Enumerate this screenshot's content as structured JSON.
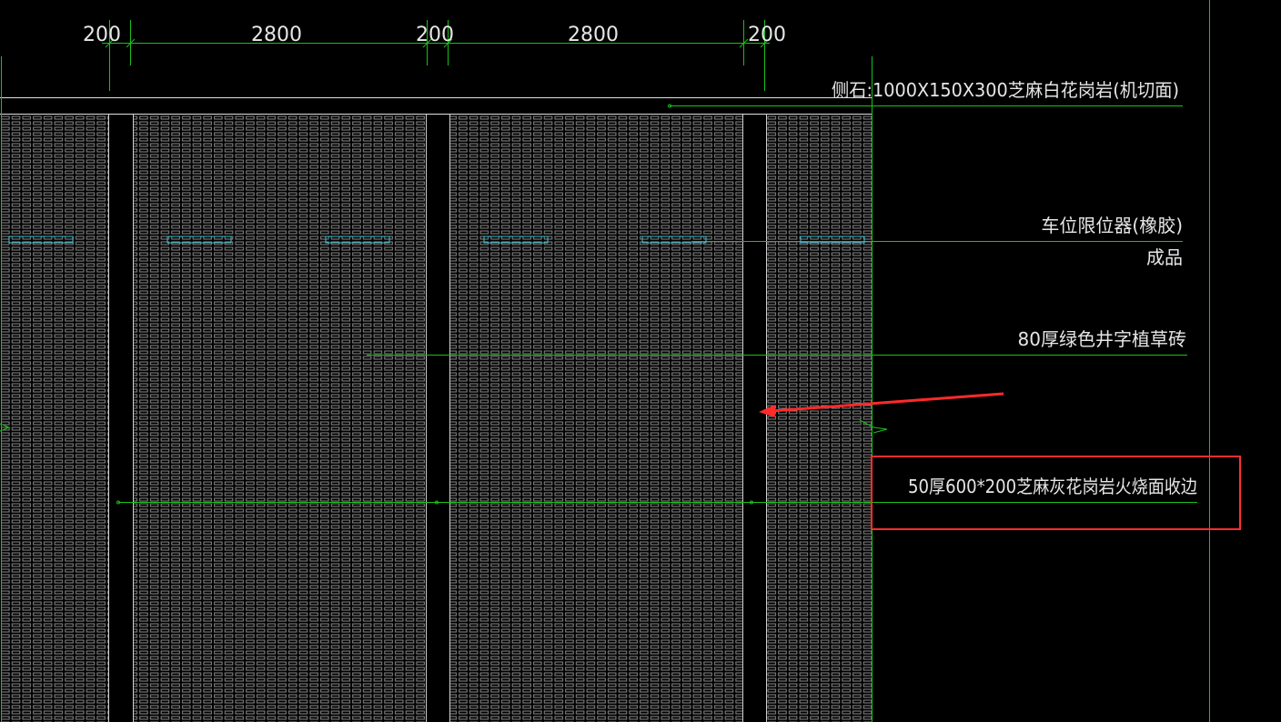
{
  "dimensions": [
    "200",
    "2800",
    "200",
    "2800",
    "200"
  ],
  "labels": {
    "curb": "侧石:1000X150X300芝麻白花岗岩(机切面)",
    "stopper_line1": "车位限位器(橡胶)",
    "stopper_line2": "成品",
    "grass_brick": "80厚绿色井字植草砖",
    "edge_stone": "50厚600*200芝麻灰花岗岩火烧面收边"
  },
  "colors": {
    "background": "#000000",
    "green_line": "#19c019",
    "hatch": "#8a8a8a",
    "stopper": "#37c4d6",
    "white_line": "#e0e0e0",
    "arrow": "#ff2a2a",
    "highlight_box": "#ff3030"
  }
}
